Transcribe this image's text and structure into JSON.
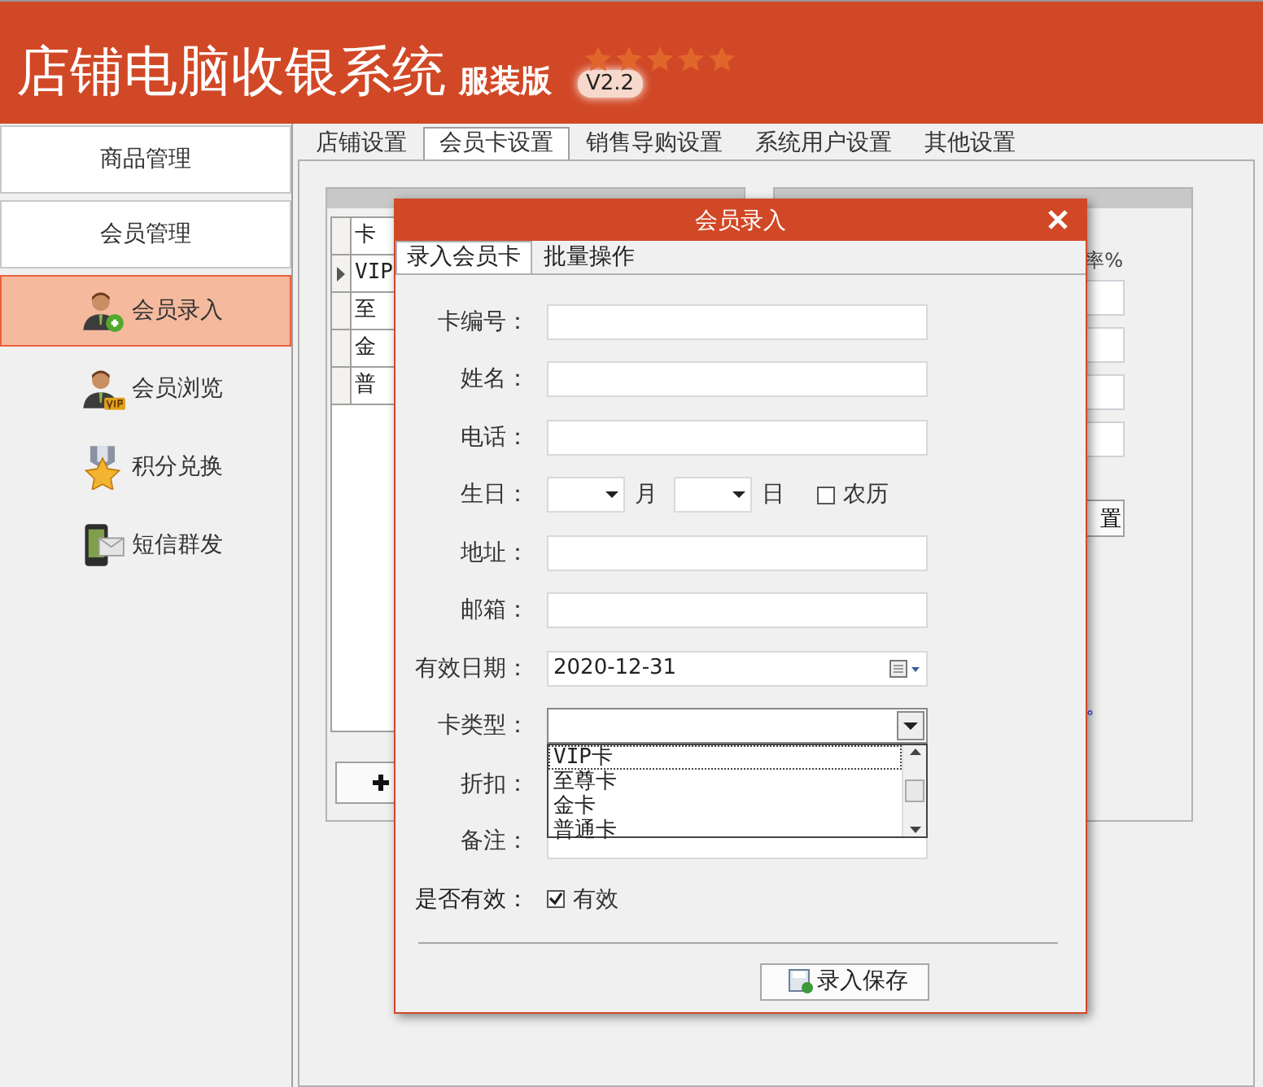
{
  "header": {
    "title": "店铺电脑收银系统",
    "edition": "服装版",
    "version": "V2.2"
  },
  "sidebar": {
    "items": [
      {
        "label": "商品管理",
        "kind": "section",
        "selected": false
      },
      {
        "label": "会员管理",
        "kind": "section",
        "selected": false
      },
      {
        "label": "会员录入",
        "kind": "member-add",
        "selected": true
      },
      {
        "label": "会员浏览",
        "kind": "member-vip",
        "selected": false
      },
      {
        "label": "积分兑换",
        "kind": "medal",
        "selected": false
      },
      {
        "label": "短信群发",
        "kind": "phone-message",
        "selected": false
      }
    ]
  },
  "tabs": [
    {
      "label": "店铺设置",
      "selected": false
    },
    {
      "label": "会员卡设置",
      "selected": true
    },
    {
      "label": "销售导购设置",
      "selected": false
    },
    {
      "label": "系统用户设置",
      "selected": false
    },
    {
      "label": "其他设置",
      "selected": false
    }
  ],
  "card_grid": {
    "header": "卡",
    "rows": [
      {
        "label": "VIP",
        "current": true
      },
      {
        "label": "至",
        "current": false
      },
      {
        "label": "金",
        "current": false
      },
      {
        "label": "普",
        "current": false
      }
    ]
  },
  "discount_panel": {
    "column_label": "率%",
    "button": "置",
    "link": "。"
  },
  "dialog": {
    "title": "会员录入",
    "tabs": [
      {
        "label": "录入会员卡",
        "selected": true
      },
      {
        "label": "批量操作",
        "selected": false
      }
    ],
    "fields": [
      {
        "kind": "text",
        "label": "卡编号："
      },
      {
        "kind": "text",
        "label": "姓名："
      },
      {
        "kind": "text",
        "label": "电话："
      },
      {
        "kind": "birthday",
        "label": "生日：",
        "month_label": "月",
        "day_label": "日",
        "lunar": {
          "label": "农历",
          "checked": false
        }
      },
      {
        "kind": "text",
        "label": "地址："
      },
      {
        "kind": "text",
        "label": "邮箱："
      },
      {
        "kind": "date",
        "label": "有效日期：",
        "value": "2020-12-31"
      },
      {
        "kind": "select",
        "label": "卡类型：",
        "expanded": true,
        "options": [
          {
            "label": "VIP卡",
            "selected": true
          },
          {
            "label": "至尊卡",
            "selected": false
          },
          {
            "label": "金卡",
            "selected": false
          },
          {
            "label": "普通卡",
            "selected": false
          }
        ]
      },
      {
        "kind": "covered",
        "label": "折扣："
      },
      {
        "kind": "text",
        "label": "备注："
      },
      {
        "kind": "checkbox",
        "label": "是否有效：",
        "box": {
          "label": "有效",
          "checked": true
        }
      }
    ],
    "save_button": "录入保存"
  }
}
